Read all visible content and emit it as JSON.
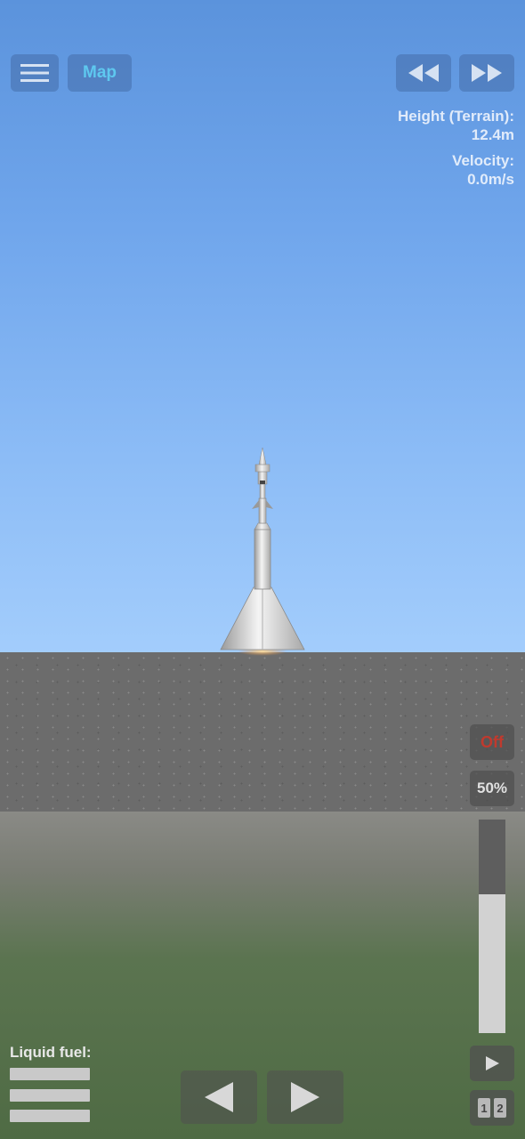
{
  "toolbar": {
    "menu_icon": "hamburger-menu-icon",
    "map_label": "Map",
    "rewind_icon": "rewind-icon",
    "fast_forward_icon": "fast-forward-icon"
  },
  "telemetry": {
    "height_label": "Height (Terrain):",
    "height_value": "12.4m",
    "velocity_label": "Velocity:",
    "velocity_value": "0.0m/s"
  },
  "controls": {
    "engine_toggle_label": "Off",
    "throttle_label": "50%",
    "throttle_fraction": 0.65,
    "stage_play_icon": "play-icon",
    "stage_numbers": [
      "1",
      "2"
    ],
    "turn_left_icon": "left-arrow-icon",
    "turn_right_icon": "right-arrow-icon"
  },
  "fuel": {
    "label": "Liquid fuel:",
    "bars": 3
  },
  "colors": {
    "map_text": "#5ec8ef",
    "engine_off_text": "#c03a2e"
  }
}
